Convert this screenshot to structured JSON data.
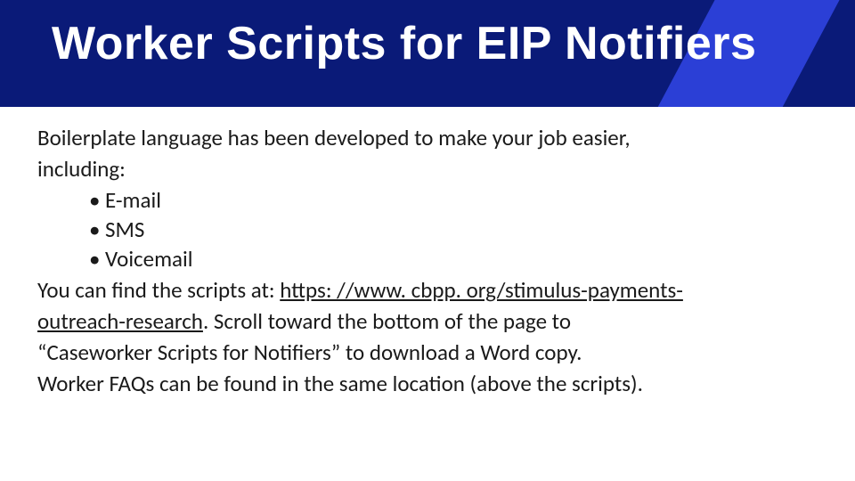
{
  "header": {
    "title": "Worker Scripts for EIP Notifiers"
  },
  "body": {
    "intro1": "Boilerplate language has been developed to make your job easier,",
    "intro2": "including:",
    "bullets": [
      "E-mail",
      "SMS",
      "Voicemail"
    ],
    "find_prefix": "You can find the scripts at: ",
    "link_line1": "https: //www. cbpp. org/stimulus-payments-",
    "link_line2": "outreach-research",
    "after_link_1": ". Scroll toward the bottom of the page to",
    "after_link_2": "“Caseworker Scripts for Notifiers” to download a Word copy.",
    "faq": "Worker FAQs can be found in the same location (above the scripts)."
  },
  "colors": {
    "navy": "#0a1a78",
    "accent": "#2b3fd6"
  }
}
